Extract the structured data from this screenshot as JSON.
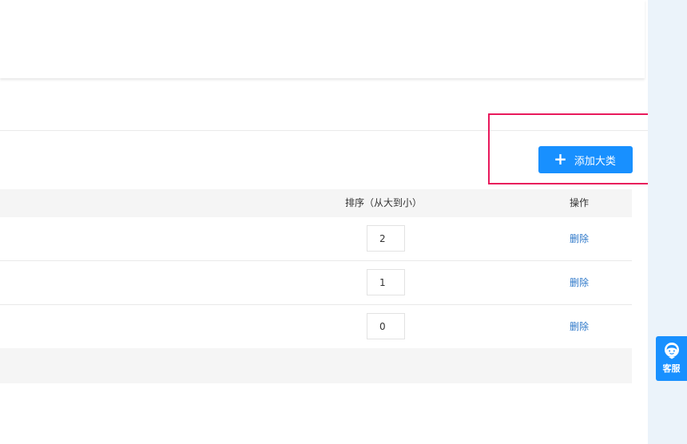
{
  "toolbar": {
    "add_button_icon": "plus-icon",
    "add_button_label": "添加大类"
  },
  "table": {
    "columns": {
      "sort": "排序（从大到小）",
      "action": "操作"
    },
    "rows": [
      {
        "sort_value": "2",
        "action_label": "删除"
      },
      {
        "sort_value": "1",
        "action_label": "删除"
      },
      {
        "sort_value": "0",
        "action_label": "删除"
      }
    ]
  },
  "customer_service": {
    "icon": "customer-service-icon",
    "label": "客服"
  },
  "colors": {
    "primary": "#1890ff",
    "highlight": "#e8185b",
    "link": "#2e78c9",
    "side_panel": "#ebf3fa"
  }
}
